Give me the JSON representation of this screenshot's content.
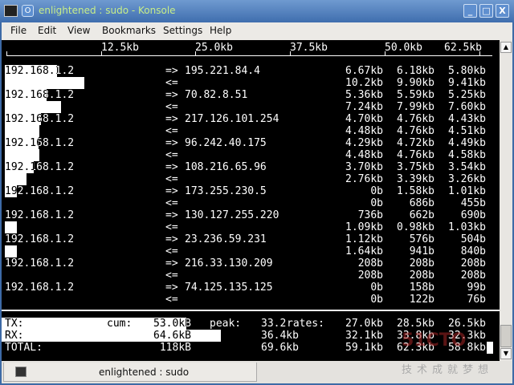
{
  "window": {
    "title": "enlightened : sudo - Konsole",
    "minimize": "_",
    "maximize": "□",
    "close": "X",
    "menu_icon": "O"
  },
  "menu": [
    "File",
    "Edit",
    "View",
    "Bookmarks",
    "Settings",
    "Help"
  ],
  "scale": [
    "12.5kb",
    "25.0kb",
    "37.5kb",
    "50.0kb",
    "62.5kb"
  ],
  "connections": [
    {
      "src": "192.168.1.2",
      "dst": "195.221.84.4",
      "tx": [
        "6.67kb",
        "6.18kb",
        "5.80kb"
      ],
      "rx": [
        "10.2kb",
        "9.90kb",
        "9.41kb"
      ],
      "tx_kb": 6.67,
      "rx_kb": 10.2
    },
    {
      "src": "192.168.1.2",
      "dst": "70.82.8.51",
      "tx": [
        "5.36kb",
        "5.59kb",
        "5.25kb"
      ],
      "rx": [
        "7.24kb",
        "7.99kb",
        "7.60kb"
      ],
      "tx_kb": 5.36,
      "rx_kb": 7.24
    },
    {
      "src": "192.168.1.2",
      "dst": "217.126.101.254",
      "tx": [
        "4.70kb",
        "4.76kb",
        "4.43kb"
      ],
      "rx": [
        "4.48kb",
        "4.76kb",
        "4.51kb"
      ],
      "tx_kb": 4.7,
      "rx_kb": 4.48
    },
    {
      "src": "192.168.1.2",
      "dst": "96.242.40.175",
      "tx": [
        "4.29kb",
        "4.72kb",
        "4.49kb"
      ],
      "rx": [
        "4.48kb",
        "4.76kb",
        "4.58kb"
      ],
      "tx_kb": 4.29,
      "rx_kb": 4.48
    },
    {
      "src": "192.168.1.2",
      "dst": "108.216.65.96",
      "tx": [
        "3.70kb",
        "3.75kb",
        "3.54kb"
      ],
      "rx": [
        "2.76kb",
        "3.39kb",
        "3.26kb"
      ],
      "tx_kb": 3.7,
      "rx_kb": 2.76
    },
    {
      "src": "192.168.1.2",
      "dst": "173.255.230.5",
      "tx": [
        "0b",
        "1.58kb",
        "1.01kb"
      ],
      "rx": [
        "0b",
        "686b",
        "455b"
      ],
      "tx_kb": 1.58,
      "rx_kb": 0
    },
    {
      "src": "192.168.1.2",
      "dst": "130.127.255.220",
      "tx": [
        "736b",
        "662b",
        "690b"
      ],
      "rx": [
        "1.09kb",
        "0.98kb",
        "1.03kb"
      ],
      "tx_kb": 0,
      "rx_kb": 1.6
    },
    {
      "src": "192.168.1.2",
      "dst": "23.236.59.231",
      "tx": [
        "1.12kb",
        "576b",
        "504b"
      ],
      "rx": [
        "1.64kb",
        "941b",
        "840b"
      ],
      "tx_kb": 0,
      "rx_kb": 1.6
    },
    {
      "src": "192.168.1.2",
      "dst": "216.33.130.209",
      "tx": [
        "208b",
        "208b",
        "208b"
      ],
      "rx": [
        "208b",
        "208b",
        "208b"
      ],
      "tx_kb": 0,
      "rx_kb": 0
    },
    {
      "src": "192.168.1.2",
      "dst": "74.125.135.125",
      "tx": [
        "0b",
        "158b",
        "99b"
      ],
      "rx": [
        "0b",
        "122b",
        "76b"
      ],
      "tx_kb": 0,
      "rx_kb": 0
    }
  ],
  "arrows": {
    "out": "=>",
    "in": "<="
  },
  "totals": {
    "tx": {
      "label": "TX:",
      "cum_label": "cum:",
      "cum": "53.0kB",
      "peak_label": "peak:",
      "peak": "33.2",
      "rates_label": "rates:",
      "rates": [
        "27.0kb",
        "28.5kb",
        "26.5kb"
      ],
      "bar_kb": 27.0
    },
    "rx": {
      "label": "RX:",
      "cum": "64.6kB",
      "peak": "36.4kb",
      "rates": [
        "32.1kb",
        "33.8kb",
        "32.3kb"
      ],
      "bar_kb": 32.1
    },
    "total": {
      "label": "TOTAL:",
      "cum": "118kB",
      "peak": "69.6kb",
      "rates": [
        "59.1kb",
        "62.3kb",
        "58.8kb"
      ]
    }
  },
  "tab": {
    "label": "enlightened : sudo"
  },
  "watermark": {
    "logo": "51CTO",
    "slogan": "技术成就梦想"
  }
}
